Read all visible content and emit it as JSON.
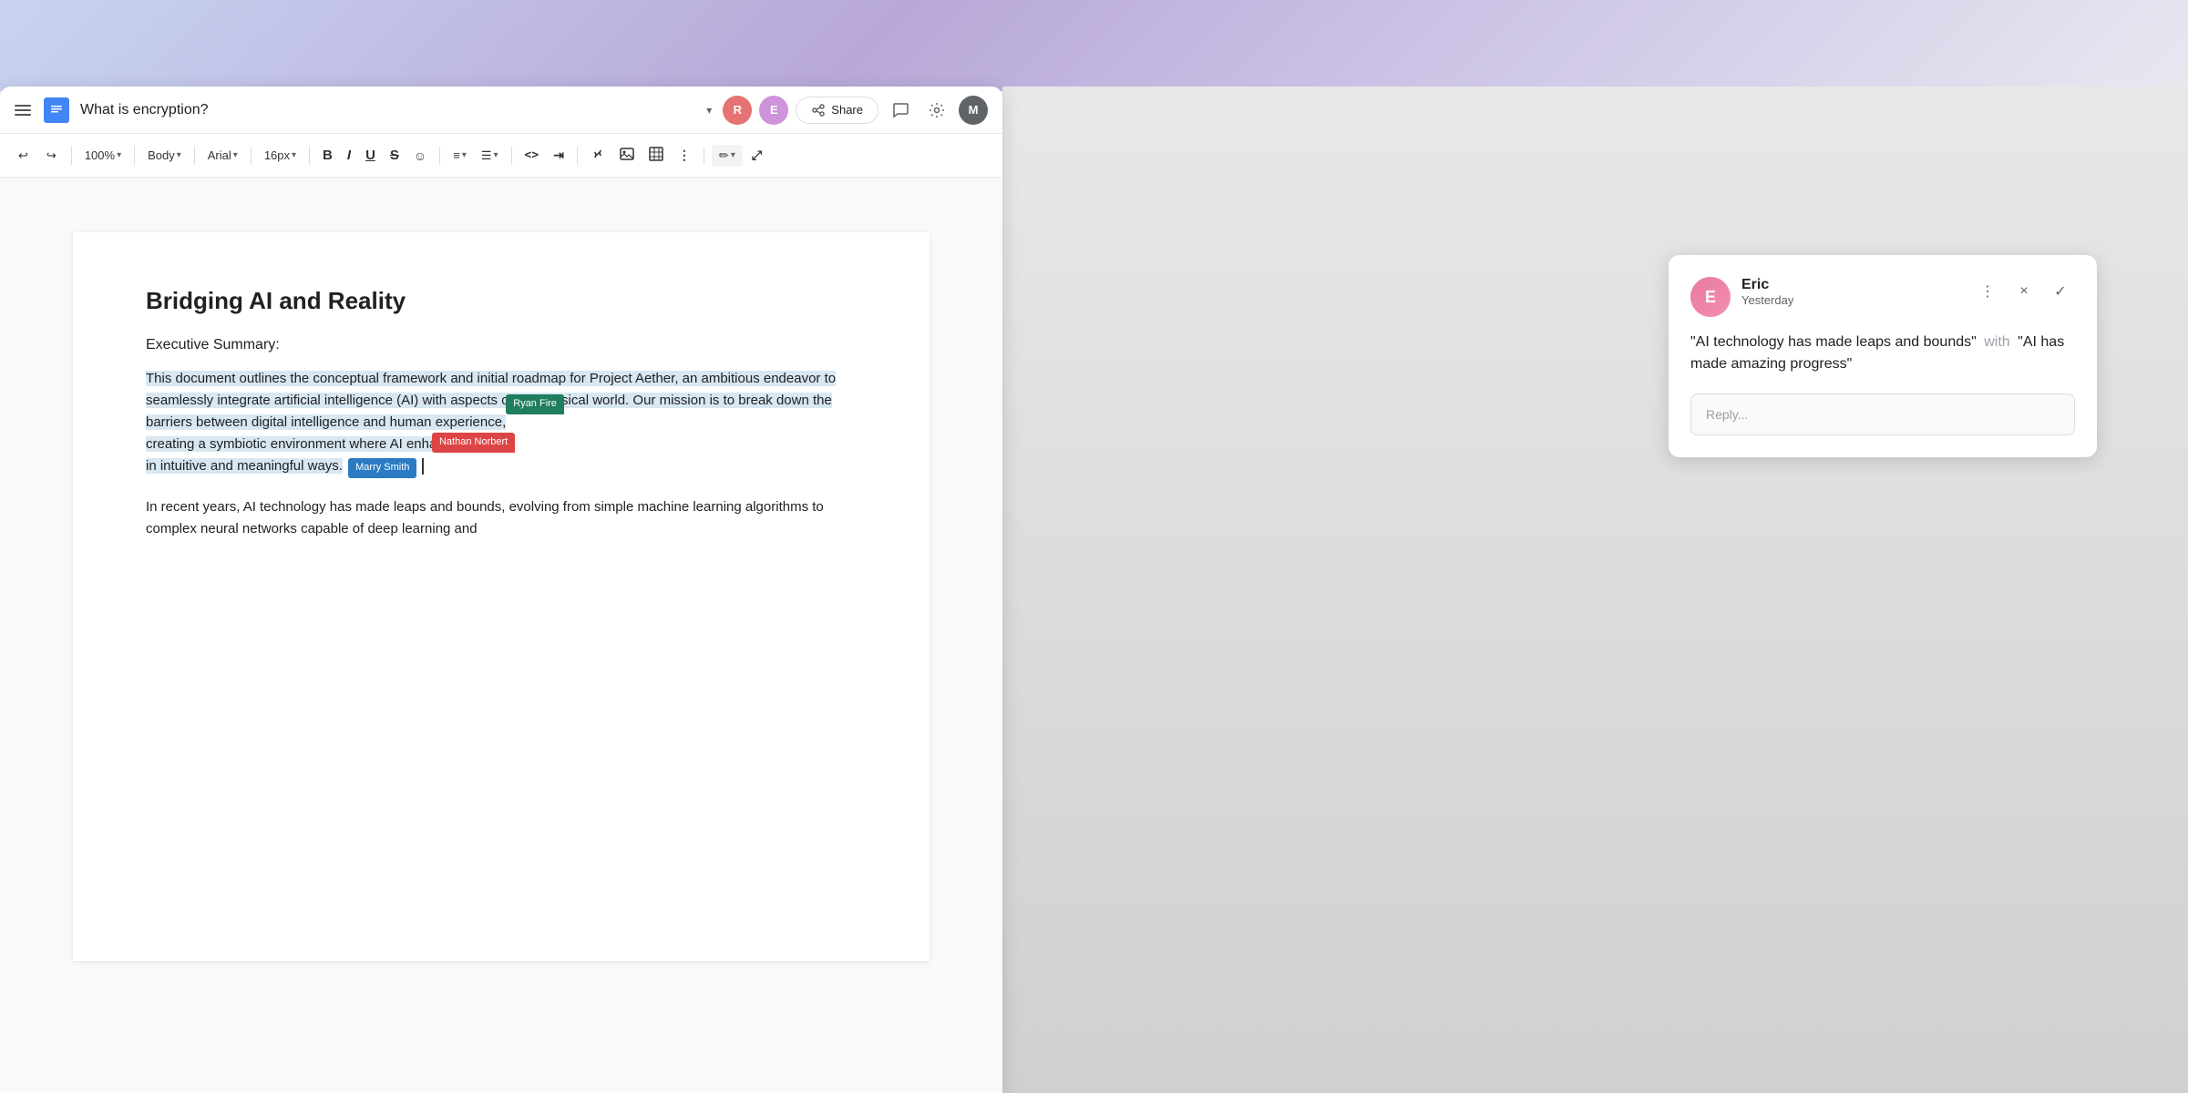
{
  "background": {
    "gradient_description": "Purple-blue gradient at top"
  },
  "titlebar": {
    "menu_label": "Menu",
    "doc_icon_letter": "D",
    "doc_title": "What is encryption?",
    "dropdown_arrow": "▾",
    "share_label": "Share",
    "avatar_r_letter": "R",
    "avatar_e_letter": "E",
    "avatar_m_letter": "M"
  },
  "toolbar": {
    "undo_label": "↩",
    "redo_label": "↪",
    "zoom_label": "100%",
    "style_label": "Body",
    "font_label": "Arial",
    "size_label": "16px",
    "bold_label": "B",
    "italic_label": "I",
    "underline_label": "U",
    "strikethrough_label": "S",
    "emoji_label": "☺",
    "align_label": "≡",
    "more_label": "⋮",
    "code_label": "<>",
    "indent_label": "⇥",
    "link_label": "🔗",
    "image_label": "🖼",
    "table_label": "⊞",
    "options_label": "⋮",
    "highlight_label": "✏",
    "expand_label": "⤢"
  },
  "document": {
    "title": "Bridging AI and Reality",
    "section_title": "Executive Summary:",
    "paragraph1": "This document outlines the conceptual framework and initial roadmap for Project Aether, an ambitious endeavor to seamlessly integrate artificial intelligence (AI) with aspects of the physical world. Our mission is to break down the barriers between digital intelligence and human experience, creating a symbiotic environment where AI enhances reality in intuitive and meaningful ways.",
    "paragraph2": "In recent years, AI technology has made leaps and bounds, evolving from simple machine learning algorithms to complex neural networks capable of deep learning and",
    "cursors": {
      "ryan": {
        "name": "Ryan Fire",
        "color": "#1e7e5e"
      },
      "nathan": {
        "name": "Nathan Norbert",
        "color": "#dd4444"
      },
      "marry": {
        "name": "Marry Smith",
        "color": "#2b7bc4"
      }
    }
  },
  "comment": {
    "author": "Eric",
    "avatar_letter": "E",
    "time": "Yesterday",
    "quote_old": "“AI technology has made leaps and bounds”",
    "connector": "with",
    "quote_new": "“AI has made amazing progress”",
    "reply_placeholder": "Reply...",
    "action_more": "⋮",
    "action_close": "×",
    "action_resolve": "✓"
  }
}
